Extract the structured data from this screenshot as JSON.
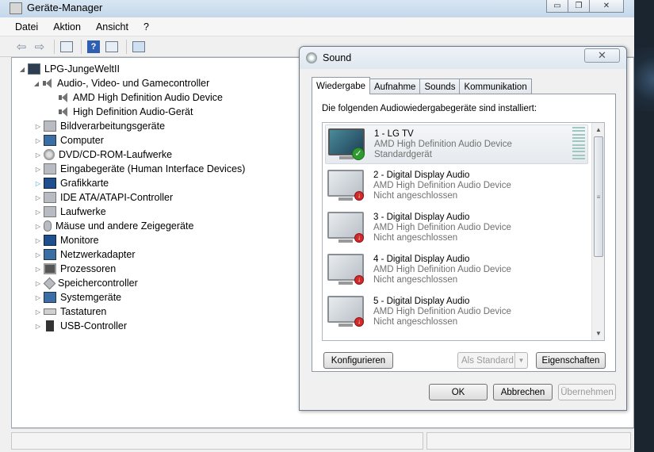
{
  "device_manager": {
    "title": "Geräte-Manager",
    "menu": [
      "Datei",
      "Aktion",
      "Ansicht",
      "?"
    ],
    "toolbar_icons": [
      "back-arrow-icon",
      "forward-arrow-icon",
      "properties-icon",
      "help-icon",
      "update-driver-icon",
      "scan-hardware-icon"
    ],
    "tree": {
      "root": "LPG-JungeWeltII",
      "audio_category": "Audio-, Video- und Gamecontroller",
      "audio_devices": [
        "AMD High Definition Audio Device",
        "High Definition Audio-Gerät"
      ],
      "categories": [
        "Bildverarbeitungsgeräte",
        "Computer",
        "DVD/CD-ROM-Laufwerke",
        "Eingabegeräte (Human Interface Devices)",
        "Grafikkarte",
        "IDE ATA/ATAPI-Controller",
        "Laufwerke",
        "Mäuse und andere Zeigegeräte",
        "Monitore",
        "Netzwerkadapter",
        "Prozessoren",
        "Speichercontroller",
        "Systemgeräte",
        "Tastaturen",
        "USB-Controller"
      ]
    }
  },
  "sound_dialog": {
    "title": "Sound",
    "close_glyph": "✕",
    "tabs": [
      "Wiedergabe",
      "Aufnahme",
      "Sounds",
      "Kommunikation"
    ],
    "active_tab": "Wiedergabe",
    "intro": "Die folgenden Audiowiedergabegeräte sind installiert:",
    "devices": [
      {
        "name": "1 - LG TV",
        "driver": "AMD High Definition Audio Device",
        "status": "Standardgerät"
      },
      {
        "name": "2 - Digital Display Audio",
        "driver": "AMD High Definition Audio Device",
        "status": "Nicht angeschlossen"
      },
      {
        "name": "3 - Digital Display Audio",
        "driver": "AMD High Definition Audio Device",
        "status": "Nicht angeschlossen"
      },
      {
        "name": "4 - Digital Display Audio",
        "driver": "AMD High Definition Audio Device",
        "status": "Nicht angeschlossen"
      },
      {
        "name": "5 - Digital Display Audio",
        "driver": "AMD High Definition Audio Device",
        "status": "Nicht angeschlossen"
      }
    ],
    "buttons": {
      "configure": "Konfigurieren",
      "set_default": "Als Standard",
      "properties": "Eigenschaften",
      "ok": "OK",
      "cancel": "Abbrechen",
      "apply": "Übernehmen"
    },
    "colors": {
      "ok_badge": "#2f9a2f",
      "error_badge": "#d12a2a"
    }
  }
}
